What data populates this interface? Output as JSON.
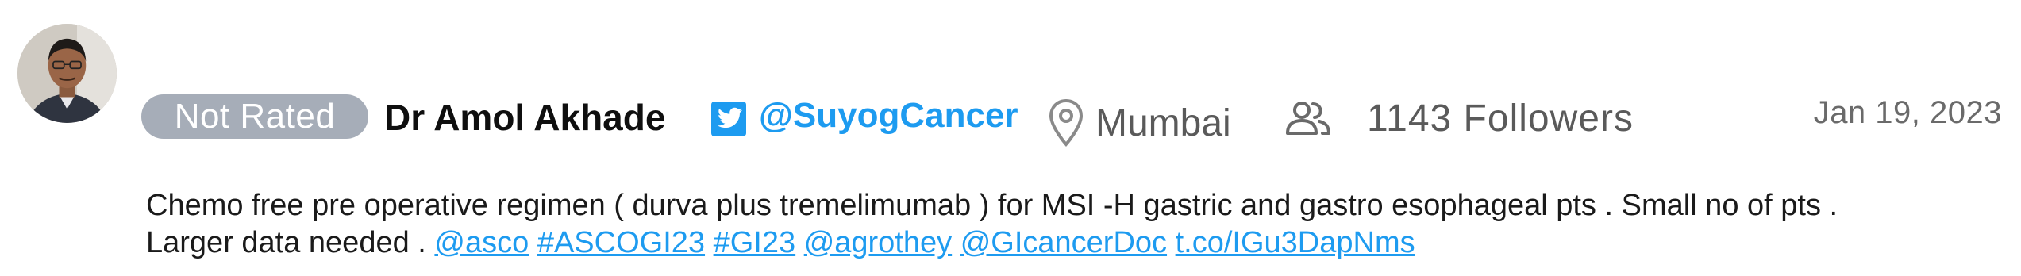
{
  "post": {
    "rating_badge": "Not Rated",
    "author_name": "Dr Amol Akhade",
    "twitter_handle": "@SuyogCancer",
    "location": "Mumbai",
    "followers": "1143 Followers",
    "date": "Jan 19, 2023",
    "text_line1": "Chemo free pre operative regimen ( durva plus tremelimumab ) for MSI -H gastric and gastro esophageal pts . Small no of pts .",
    "text_line2_start": "Larger data needed .",
    "links": [
      "@asco",
      "#ASCOGI23",
      "#GI23",
      "@agrothey",
      "@GIcancerDoc",
      "t.co/IGu3DapNms"
    ]
  },
  "icons": {
    "avatar": "avatar",
    "twitter": "twitter-icon",
    "location": "location-pin-icon",
    "followers": "people-icon"
  },
  "colors": {
    "link": "#1d9bf0",
    "badge_bg": "#a6adb8",
    "muted_text": "#5a5a5a"
  }
}
